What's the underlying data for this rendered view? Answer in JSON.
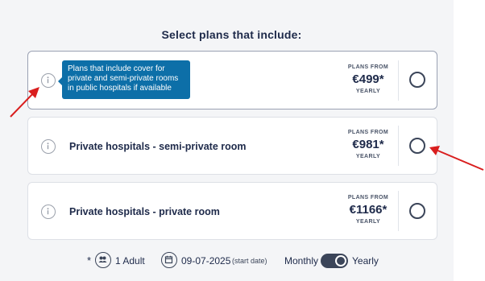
{
  "heading": "Select plans that include:",
  "plans": [
    {
      "title": "",
      "from_label": "PLANS FROM",
      "price": "€499*",
      "period": "YEARLY"
    },
    {
      "title": "Private hospitals - semi-private room",
      "from_label": "PLANS FROM",
      "price": "€981*",
      "period": "YEARLY"
    },
    {
      "title": "Private hospitals - private room",
      "from_label": "PLANS FROM",
      "price": "€1166*",
      "period": "YEARLY"
    }
  ],
  "tooltip": {
    "text": "Plans that include cover for private and semi-private rooms in public hospitals if available"
  },
  "footer": {
    "asterisk": "*",
    "adults": "1 Adult",
    "date": "09-07-2025",
    "date_note": "(start date)",
    "monthly": "Monthly",
    "yearly": "Yearly",
    "billing_selected": "Yearly"
  },
  "colors": {
    "tooltip": "#0d6fa8",
    "annotation_arrow": "#d91e1e",
    "text": "#1e2a4a"
  }
}
